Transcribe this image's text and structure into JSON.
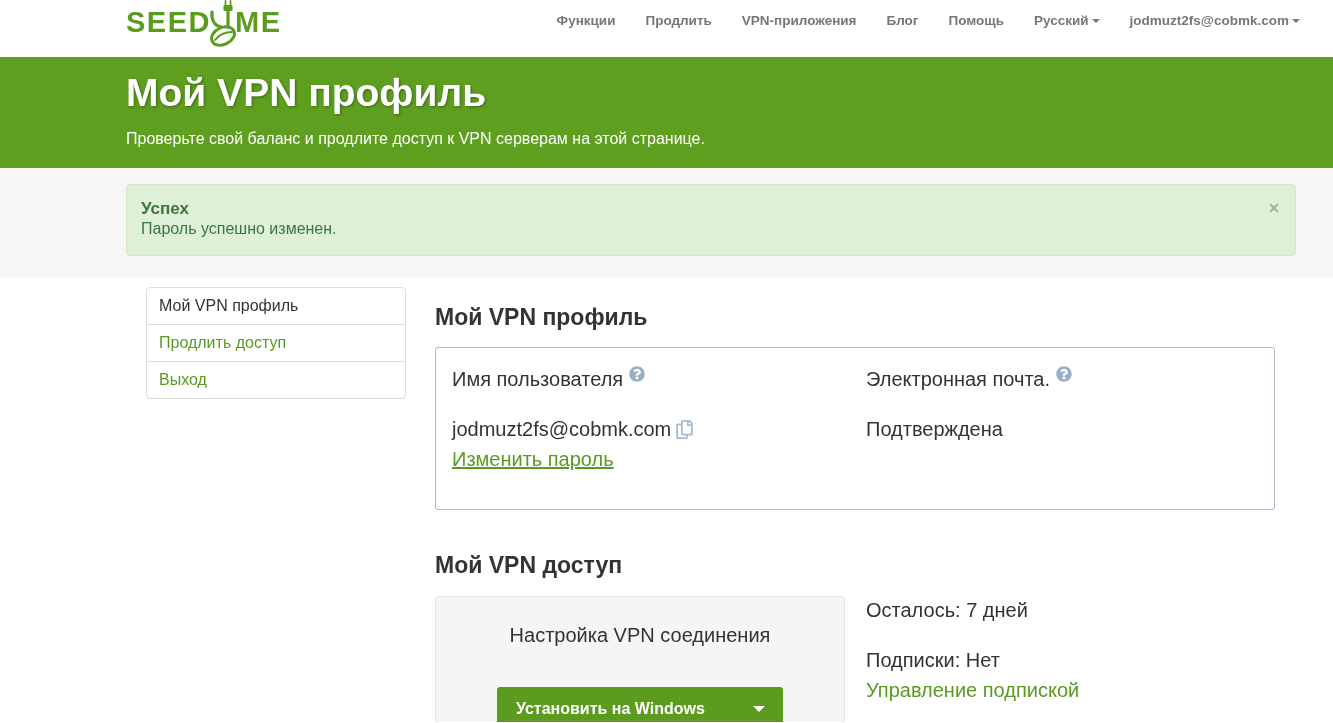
{
  "navbar": {
    "logo": {
      "left": "SEED",
      "right": "ME"
    },
    "items": [
      {
        "label": "Функции",
        "dropdown": false
      },
      {
        "label": "Продлить",
        "dropdown": false
      },
      {
        "label": "VPN-приложения",
        "dropdown": false
      },
      {
        "label": "Блог",
        "dropdown": false
      },
      {
        "label": "Помощь",
        "dropdown": false
      },
      {
        "label": "Русский",
        "dropdown": true
      },
      {
        "label": "jodmuzt2fs@cobmk.com",
        "dropdown": true
      }
    ]
  },
  "header": {
    "title": "Мой VPN профиль",
    "subtitle": "Проверьте свой баланс и продлите доступ к VPN серверам на этой странице."
  },
  "alert": {
    "kind": "success",
    "title": "Успех",
    "message": "Пароль успешно изменен.",
    "dismissible": true
  },
  "sidebar": {
    "items": [
      {
        "label": "Мой VPN профиль",
        "selected": true
      },
      {
        "label": "Продлить доступ",
        "selected": false
      },
      {
        "label": "Выход",
        "selected": false
      }
    ]
  },
  "profile": {
    "heading": "Мой VPN профиль",
    "fields": [
      {
        "label": "Имя пользователя",
        "help": true,
        "value": "jodmuzt2fs@cobmk.com",
        "copyable": true,
        "link": "Изменить пароль"
      },
      {
        "label": "Электронная почта.",
        "help": true,
        "value": "Подтверждена",
        "copyable": false
      }
    ]
  },
  "access": {
    "heading": "Мой VPN доступ",
    "setup": {
      "title": "Настройка VPN соединения",
      "button": {
        "label": "Установить на Windows",
        "dropdown": true
      }
    },
    "remaining": "Осталось: 7 дней",
    "subscriptions": "Подписки: Нет",
    "manage_link": "Управление подпиской"
  }
}
